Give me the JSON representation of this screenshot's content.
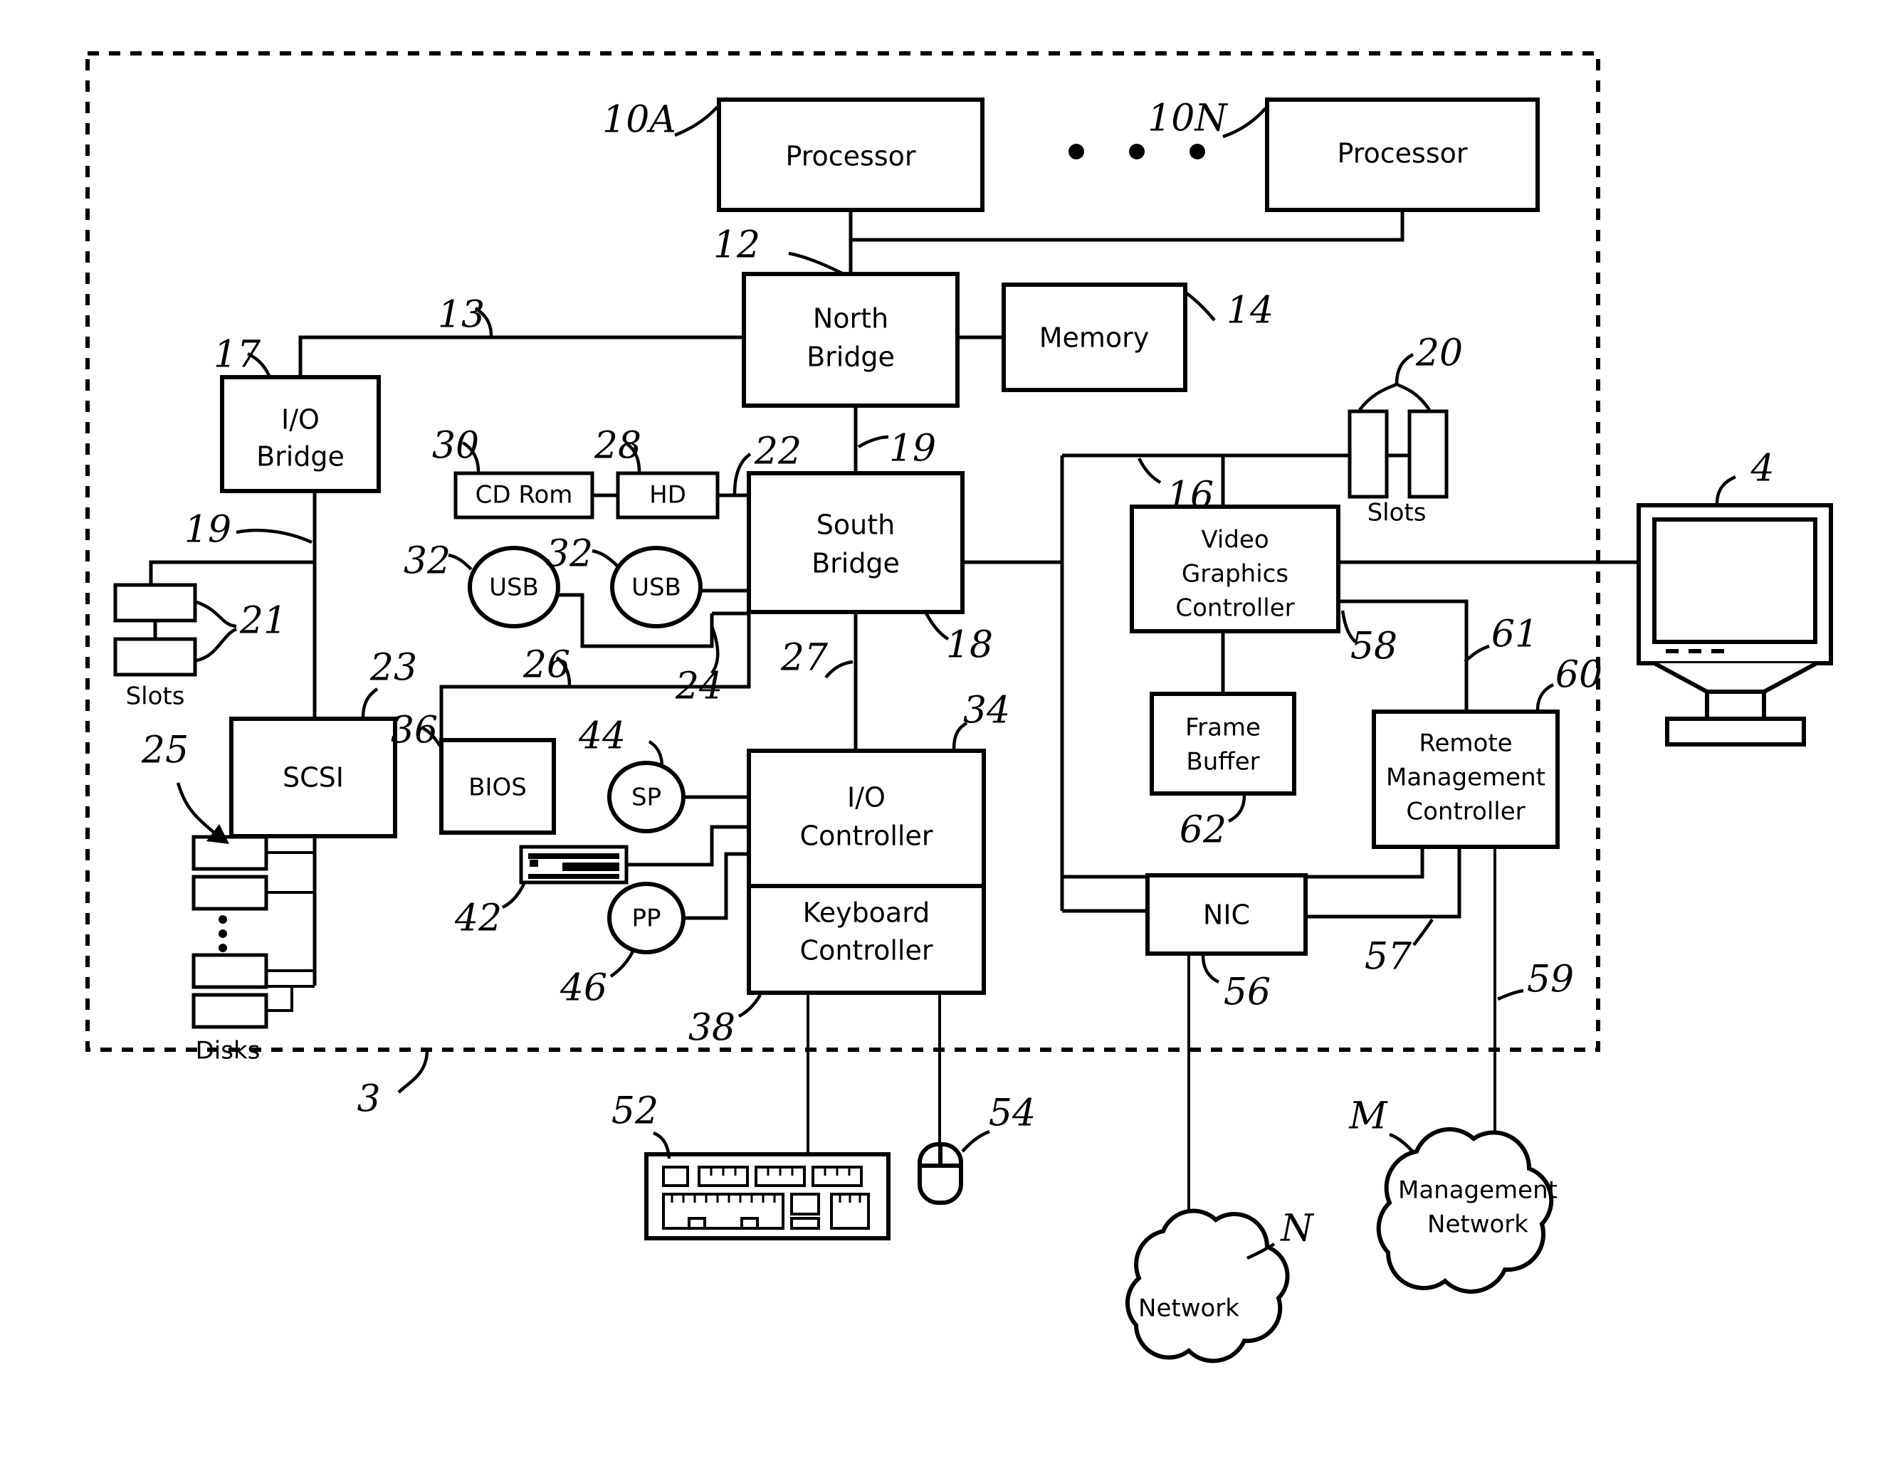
{
  "figure": {
    "type": "patent-block-diagram",
    "subject": "Computer system with remote management controller"
  },
  "enclosure": {
    "name": "system-boundary",
    "ref": "3"
  },
  "blocks": {
    "processor_a": {
      "label": "Processor",
      "ref": "10A"
    },
    "processor_n": {
      "label": "Processor",
      "ref": "10N"
    },
    "north_bridge": {
      "label_line1": "North",
      "label_line2": "Bridge",
      "ref": "12"
    },
    "memory": {
      "label": "Memory",
      "ref": "14"
    },
    "io_bridge": {
      "label_line1": "I/O",
      "label_line2": "Bridge",
      "ref": "17"
    },
    "slots_left": {
      "label": "Slots",
      "ref": "21"
    },
    "scsi": {
      "label": "SCSI",
      "ref": "23"
    },
    "disks": {
      "label": "Disks",
      "ref": "25"
    },
    "cd_rom": {
      "label": "CD Rom",
      "ref": "30"
    },
    "hd": {
      "label": "HD",
      "ref": "28"
    },
    "usb_left": {
      "label": "USB",
      "ref": "32"
    },
    "usb_right": {
      "label": "USB",
      "ref": "32"
    },
    "south_bridge": {
      "label_line1": "South",
      "label_line2": "Bridge",
      "ref": "18"
    },
    "bios": {
      "label": "BIOS",
      "ref": "36"
    },
    "serial_port": {
      "label": "SP",
      "ref": "44"
    },
    "parallel_port": {
      "label": "PP",
      "ref": "46"
    },
    "floppy_drive": {
      "label": "",
      "ref": "42"
    },
    "io_controller": {
      "label_line1": "I/O",
      "label_line2": "Controller",
      "ref": "34"
    },
    "keyboard_controller": {
      "label_line1": "Keyboard",
      "label_line2": "Controller",
      "ref": "38"
    },
    "video_graphics_controller": {
      "label_line1": "Video",
      "label_line2": "Graphics",
      "label_line3": "Controller",
      "ref": "16"
    },
    "frame_buffer": {
      "label_line1": "Frame",
      "label_line2": "Buffer",
      "ref": "62"
    },
    "slots_right": {
      "label": "Slots",
      "ref": "20"
    },
    "remote_management_controller": {
      "label_line1": "Remote",
      "label_line2": "Management",
      "label_line3": "Controller",
      "ref": "60"
    },
    "nic": {
      "label": "NIC",
      "ref": "56"
    },
    "monitor": {
      "label": "",
      "ref": "4"
    },
    "keyboard": {
      "label": "",
      "ref": "52"
    },
    "mouse": {
      "label": "",
      "ref": "54"
    },
    "network_cloud": {
      "label": "Network",
      "ref": "N"
    },
    "management_network_cloud": {
      "label_line1": "Management",
      "label_line2": "Network",
      "ref": "M"
    }
  },
  "bus_refs": {
    "processor_bus": "12",
    "north_to_io_bridge": "13",
    "io_bridge_bus": "19",
    "north_to_south": "19",
    "hd_to_south": "22",
    "usb_to_south": "24",
    "south_to_bios_bus": "26",
    "south_to_io_controller": "27",
    "vgc_to_rmc": "58",
    "rmc_link_61": "61",
    "nic_to_rmc": "57",
    "rmc_to_mgmt_network": "59"
  },
  "ellipsis": {
    "processor_dots": 3,
    "disk_dots": 3
  },
  "colors": {
    "ink": "#000000",
    "paper": "#ffffff"
  }
}
